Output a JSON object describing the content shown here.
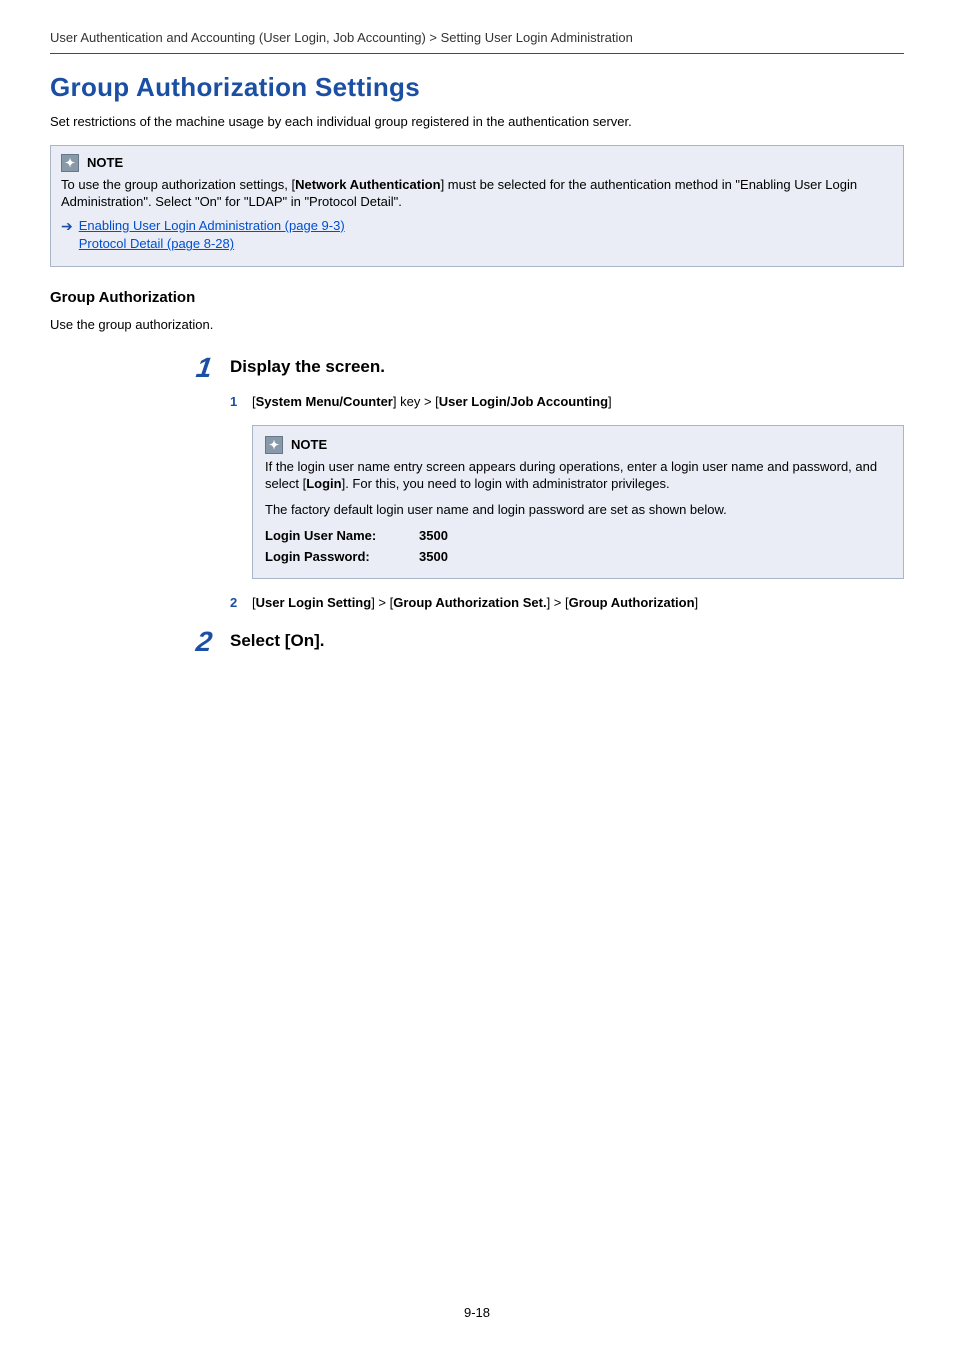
{
  "breadcrumb": "User Authentication and Accounting (User Login, Job Accounting) > Setting User Login Administration",
  "h1": "Group Authorization Settings",
  "intro": "Set restrictions of the machine usage by each individual group registered in the authentication server.",
  "note1": {
    "title": "NOTE",
    "body_pre": "To use the group authorization settings, [",
    "body_bold": "Network Authentication",
    "body_post": "] must be selected for the authentication method in \"Enabling User Login Administration\". Select \"On\" for \"LDAP\" in \"Protocol Detail\".",
    "links": [
      "Enabling User Login Administration (page 9-3)",
      "Protocol Detail (page 8-28)"
    ]
  },
  "h2": "Group Authorization",
  "para2": "Use the group authorization.",
  "step1": {
    "num": "1",
    "title": "Display the screen.",
    "sub1": {
      "num": "1",
      "pre": "[",
      "b1": "System Menu/Counter",
      "mid": "] key > [",
      "b2": "User Login/Job Accounting",
      "post": "]"
    },
    "innerNote": {
      "title": "NOTE",
      "p1_pre": "If the login user name entry screen appears during operations, enter a login user name and password, and select [",
      "p1_bold": "Login",
      "p1_post": "]. For this, you need to login with administrator privileges.",
      "p2": "The factory default login user name and login password are set as shown below.",
      "cred1_label": "Login User Name:",
      "cred1_val": "3500",
      "cred2_label": "Login Password:",
      "cred2_val": "3500"
    },
    "sub2": {
      "num": "2",
      "pre": "[",
      "b1": "User Login Setting",
      "m1": "] > [",
      "b2": "Group Authorization Set.",
      "m2": "] > [",
      "b3": "Group Authorization",
      "post": "]"
    }
  },
  "step2": {
    "num": "2",
    "title": "Select [On]."
  },
  "pageNum": "9-18"
}
